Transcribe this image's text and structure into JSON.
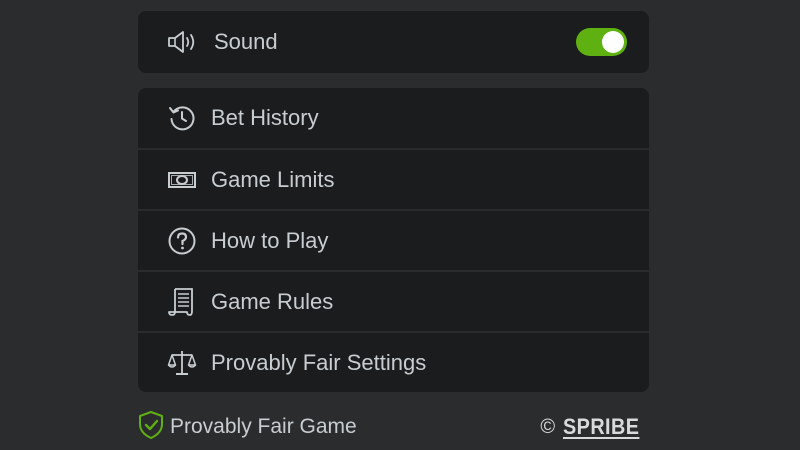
{
  "sound": {
    "label": "Sound",
    "enabled": true,
    "icon": "speaker-icon"
  },
  "menu": {
    "items": [
      {
        "label": "Bet History",
        "icon": "history-icon"
      },
      {
        "label": "Game Limits",
        "icon": "banknote-icon"
      },
      {
        "label": "How to Play",
        "icon": "question-circle-icon"
      },
      {
        "label": "Game Rules",
        "icon": "scroll-icon"
      },
      {
        "label": "Provably Fair Settings",
        "icon": "scales-icon"
      }
    ]
  },
  "footer": {
    "fair_label": "Provably Fair Game",
    "copyright_symbol": "©",
    "brand": "SPRIBE"
  },
  "colors": {
    "background": "#2b2c2e",
    "card": "#1b1c1d",
    "toggle_on": "#5fb011",
    "text": "#c8cdd1",
    "shield": "#5fb011"
  }
}
